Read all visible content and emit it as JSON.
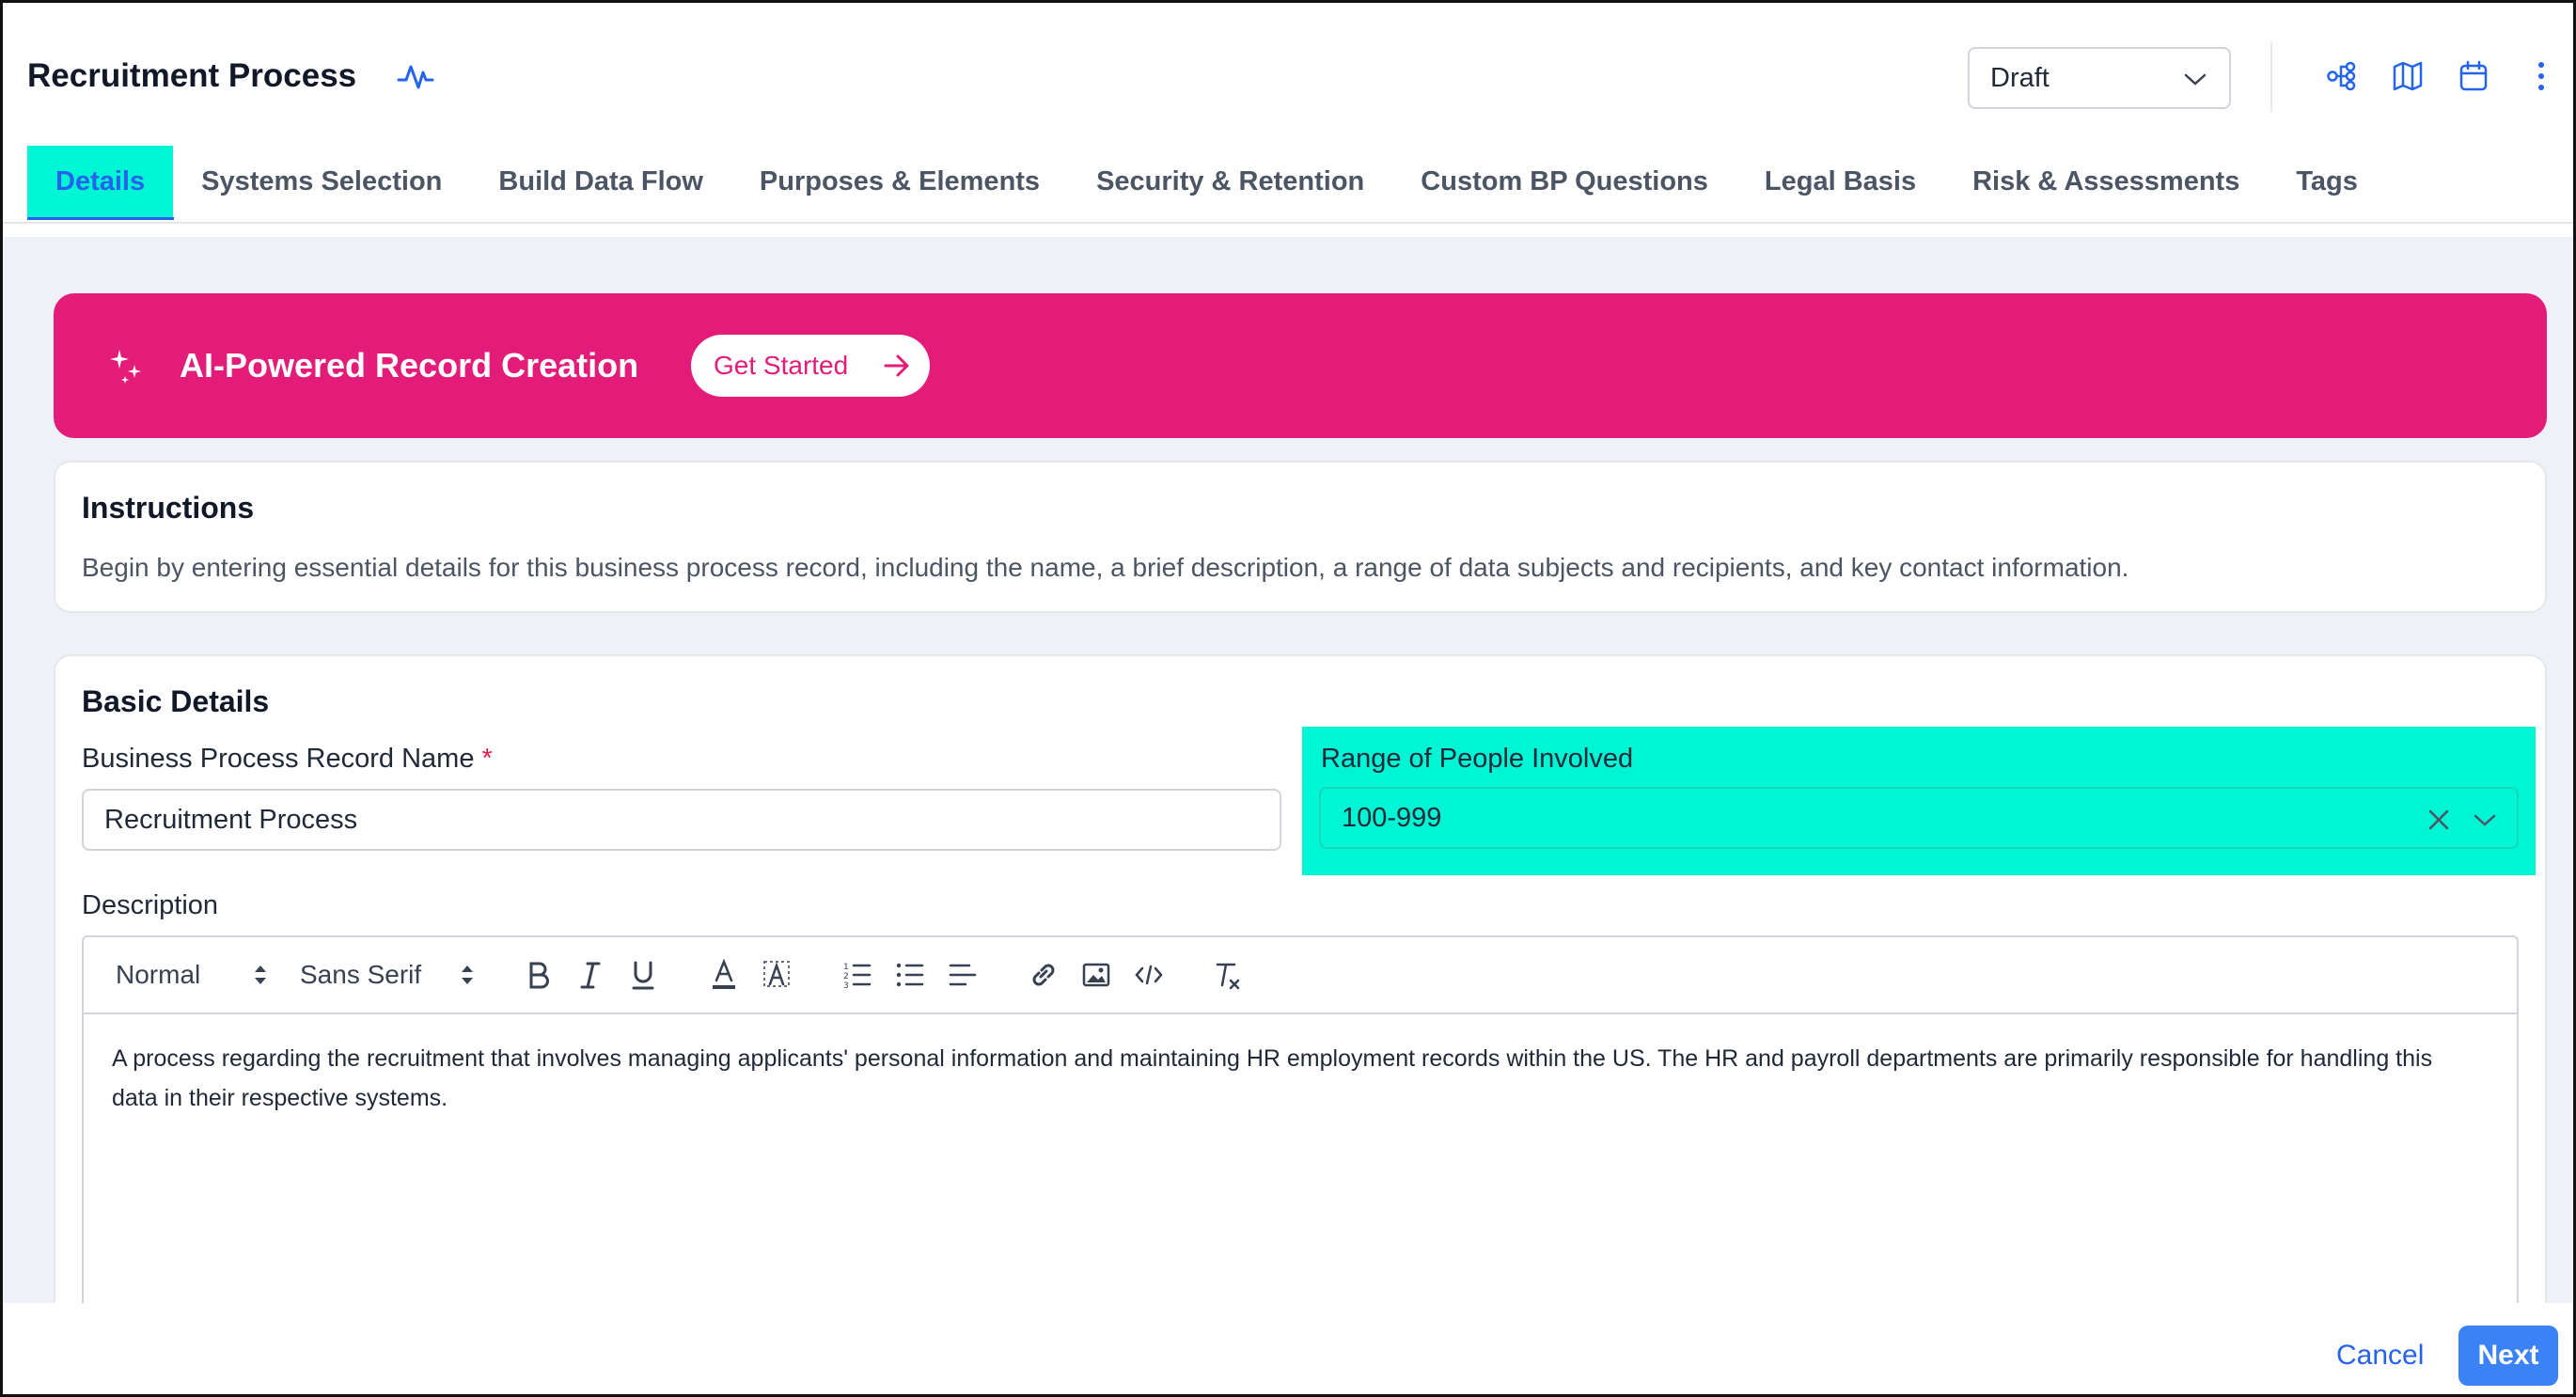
{
  "header": {
    "title": "Recruitment Process",
    "status_value": "Draft",
    "icons": [
      "activity-icon",
      "flow-diagram-icon",
      "map-icon",
      "calendar-icon",
      "more-vertical-icon"
    ]
  },
  "tabs": [
    {
      "label": "Details",
      "active": true
    },
    {
      "label": "Systems Selection",
      "active": false
    },
    {
      "label": "Build Data Flow",
      "active": false
    },
    {
      "label": "Purposes & Elements",
      "active": false
    },
    {
      "label": "Security & Retention",
      "active": false
    },
    {
      "label": "Custom BP Questions",
      "active": false
    },
    {
      "label": "Legal Basis",
      "active": false
    },
    {
      "label": "Risk & Assessments",
      "active": false
    },
    {
      "label": "Tags",
      "active": false
    }
  ],
  "ai_banner": {
    "title": "AI-Powered Record Creation",
    "button_label": "Get Started",
    "color": "#e31c79"
  },
  "instructions": {
    "title": "Instructions",
    "text": "Begin by entering essential details for this business process record, including the name, a brief description, a range of data subjects and recipients, and key contact information."
  },
  "basic_details": {
    "title": "Basic Details",
    "name_label": "Business Process Record Name",
    "required_mark": "*",
    "name_value": "Recruitment Process",
    "range_label": "Range of People Involved",
    "range_value": "100-999",
    "description_label": "Description",
    "toolbar": {
      "size_value": "Normal",
      "font_value": "Sans Serif",
      "buttons": [
        "bold",
        "italic",
        "underline",
        "text-color",
        "background-color",
        "ordered-list",
        "bullet-list",
        "align",
        "link",
        "image",
        "code",
        "clear-format"
      ]
    },
    "description_text": "A process regarding the recruitment that involves managing applicants' personal information and maintaining HR employment records within the US. The HR and payroll departments are primarily responsible for handling this data in their respective systems."
  },
  "footer": {
    "cancel_label": "Cancel",
    "next_label": "Next"
  },
  "colors": {
    "accent": "#2563eb",
    "highlight": "#00f5d4",
    "banner": "#e31c79"
  }
}
